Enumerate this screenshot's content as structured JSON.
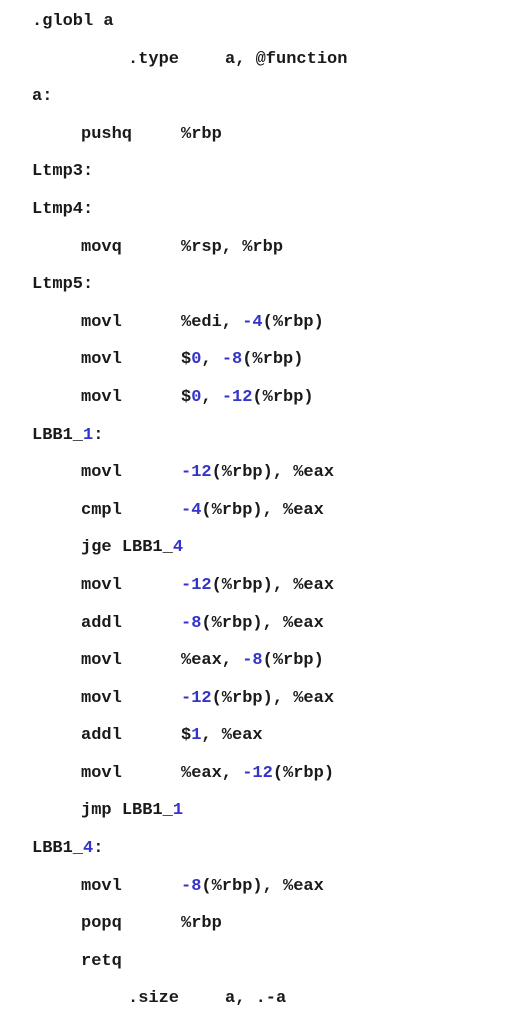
{
  "colors": {
    "text": "#1a1a1a",
    "number": "#3434c8",
    "background": "#ffffff"
  },
  "lines": [
    {
      "kind": "label",
      "parts": [
        {
          "t": ".globl a"
        }
      ]
    },
    {
      "kind": "directive",
      "name": ".type",
      "args": [
        {
          "t": "a, @function"
        }
      ]
    },
    {
      "kind": "label",
      "parts": [
        {
          "t": "a:"
        }
      ]
    },
    {
      "kind": "instr",
      "mnemonic": "pushq",
      "operands": [
        {
          "t": "%rbp"
        }
      ]
    },
    {
      "kind": "label",
      "parts": [
        {
          "t": "Ltmp3:"
        }
      ]
    },
    {
      "kind": "label",
      "parts": [
        {
          "t": "Ltmp4:"
        }
      ]
    },
    {
      "kind": "instr",
      "mnemonic": "movq",
      "operands": [
        {
          "t": "%rsp, %rbp"
        }
      ]
    },
    {
      "kind": "label",
      "parts": [
        {
          "t": "Ltmp5:"
        }
      ]
    },
    {
      "kind": "instr",
      "mnemonic": "movl",
      "operands": [
        {
          "t": "%edi, "
        },
        {
          "t": "-4",
          "num": true
        },
        {
          "t": "(%rbp)"
        }
      ]
    },
    {
      "kind": "instr",
      "mnemonic": "movl",
      "operands": [
        {
          "t": "$"
        },
        {
          "t": "0",
          "num": true
        },
        {
          "t": ", "
        },
        {
          "t": "-8",
          "num": true
        },
        {
          "t": "(%rbp)"
        }
      ]
    },
    {
      "kind": "instr",
      "mnemonic": "movl",
      "operands": [
        {
          "t": "$"
        },
        {
          "t": "0",
          "num": true
        },
        {
          "t": ", "
        },
        {
          "t": "-12",
          "num": true
        },
        {
          "t": "(%rbp)"
        }
      ]
    },
    {
      "kind": "label",
      "parts": [
        {
          "t": "LBB1_"
        },
        {
          "t": "1",
          "num": true
        },
        {
          "t": ":"
        }
      ]
    },
    {
      "kind": "instr",
      "mnemonic": "movl",
      "operands": [
        {
          "t": "-12",
          "num": true
        },
        {
          "t": "(%rbp), %eax"
        }
      ]
    },
    {
      "kind": "instr",
      "mnemonic": "cmpl",
      "operands": [
        {
          "t": "-4",
          "num": true
        },
        {
          "t": "(%rbp), %eax"
        }
      ]
    },
    {
      "kind": "jump",
      "mnemonic": "jge",
      "target": [
        {
          "t": "LBB1_"
        },
        {
          "t": "4",
          "num": true
        }
      ]
    },
    {
      "kind": "instr",
      "mnemonic": "movl",
      "operands": [
        {
          "t": "-12",
          "num": true
        },
        {
          "t": "(%rbp), %eax"
        }
      ]
    },
    {
      "kind": "instr",
      "mnemonic": "addl",
      "operands": [
        {
          "t": "-8",
          "num": true
        },
        {
          "t": "(%rbp), %eax"
        }
      ]
    },
    {
      "kind": "instr",
      "mnemonic": "movl",
      "operands": [
        {
          "t": "%eax, "
        },
        {
          "t": "-8",
          "num": true
        },
        {
          "t": "(%rbp)"
        }
      ]
    },
    {
      "kind": "instr",
      "mnemonic": "movl",
      "operands": [
        {
          "t": "-12",
          "num": true
        },
        {
          "t": "(%rbp), %eax"
        }
      ]
    },
    {
      "kind": "instr",
      "mnemonic": "addl",
      "operands": [
        {
          "t": "$"
        },
        {
          "t": "1",
          "num": true
        },
        {
          "t": ", %eax"
        }
      ]
    },
    {
      "kind": "instr",
      "mnemonic": "movl",
      "operands": [
        {
          "t": "%eax, "
        },
        {
          "t": "-12",
          "num": true
        },
        {
          "t": "(%rbp)"
        }
      ]
    },
    {
      "kind": "jump",
      "mnemonic": "jmp",
      "target": [
        {
          "t": "LBB1_"
        },
        {
          "t": "1",
          "num": true
        }
      ]
    },
    {
      "kind": "label",
      "parts": [
        {
          "t": "LBB1_"
        },
        {
          "t": "4",
          "num": true
        },
        {
          "t": ":"
        }
      ]
    },
    {
      "kind": "instr",
      "mnemonic": "movl",
      "operands": [
        {
          "t": "-8",
          "num": true
        },
        {
          "t": "(%rbp), %eax"
        }
      ]
    },
    {
      "kind": "instr",
      "mnemonic": "popq",
      "operands": [
        {
          "t": "%rbp"
        }
      ]
    },
    {
      "kind": "instr",
      "mnemonic": "retq",
      "operands": []
    },
    {
      "kind": "directive",
      "name": ".size",
      "args": [
        {
          "t": "a, .-a"
        }
      ]
    }
  ]
}
